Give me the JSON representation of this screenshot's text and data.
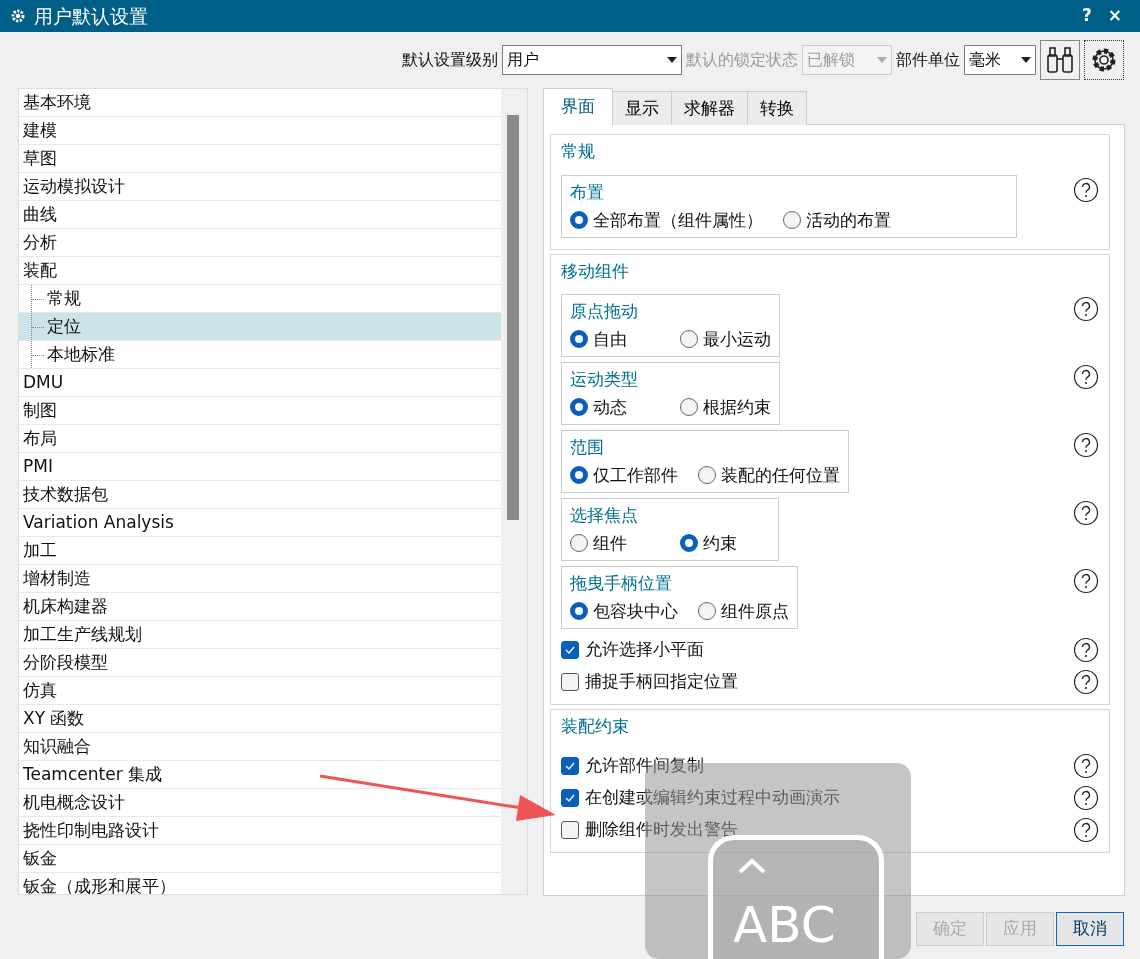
{
  "window": {
    "title": "用户默认设置",
    "help": "?",
    "close": "×"
  },
  "toolbar": {
    "level_label": "默认设置级别",
    "level_value": "用户",
    "lock_label": "默认的锁定状态",
    "lock_value": "已解锁",
    "lock_disabled": true,
    "units_label": "部件单位",
    "units_value": "毫米"
  },
  "sidebar": {
    "items": [
      {
        "label": "基本环境",
        "selected": false
      },
      {
        "label": "建模",
        "selected": false
      },
      {
        "label": "草图",
        "selected": false
      },
      {
        "label": "运动模拟设计",
        "selected": false
      },
      {
        "label": "曲线",
        "selected": false
      },
      {
        "label": "分析",
        "selected": false
      },
      {
        "label": "装配",
        "selected": false,
        "children": [
          {
            "label": "常规",
            "selected": false
          },
          {
            "label": "定位",
            "selected": true
          },
          {
            "label": "本地标准",
            "selected": false
          }
        ]
      },
      {
        "label": "DMU",
        "selected": false
      },
      {
        "label": "制图",
        "selected": false
      },
      {
        "label": "布局",
        "selected": false
      },
      {
        "label": "PMI",
        "selected": false
      },
      {
        "label": "技术数据包",
        "selected": false
      },
      {
        "label": "Variation Analysis",
        "selected": false
      },
      {
        "label": "加工",
        "selected": false
      },
      {
        "label": "增材制造",
        "selected": false
      },
      {
        "label": "机床构建器",
        "selected": false
      },
      {
        "label": "加工生产线规划",
        "selected": false
      },
      {
        "label": "分阶段模型",
        "selected": false
      },
      {
        "label": "仿真",
        "selected": false
      },
      {
        "label": "XY 函数",
        "selected": false
      },
      {
        "label": "知识融合",
        "selected": false
      },
      {
        "label": "Teamcenter 集成",
        "selected": false
      },
      {
        "label": "机电概念设计",
        "selected": false
      },
      {
        "label": "挠性印制电路设计",
        "selected": false
      },
      {
        "label": "钣金",
        "selected": false
      },
      {
        "label": "钣金（成形和展平）",
        "selected": false
      }
    ]
  },
  "tabs": [
    {
      "label": "界面",
      "selected": true
    },
    {
      "label": "显示",
      "selected": false
    },
    {
      "label": "求解器",
      "selected": false
    },
    {
      "label": "转换",
      "selected": false
    }
  ],
  "sections": [
    {
      "title": "常规",
      "items": [
        {
          "kind": "radio",
          "title": "布置",
          "options": [
            {
              "label": "全部布置（组件属性）",
              "selected": true
            },
            {
              "label": "活动的布置",
              "selected": false
            }
          ]
        }
      ]
    },
    {
      "title": "移动组件",
      "items": [
        {
          "kind": "radio",
          "title": "原点拖动",
          "options": [
            {
              "label": "自由",
              "selected": true
            },
            {
              "label": "最小运动",
              "selected": false
            }
          ]
        },
        {
          "kind": "radio",
          "title": "运动类型",
          "options": [
            {
              "label": "动态",
              "selected": true
            },
            {
              "label": "根据约束",
              "selected": false
            }
          ]
        },
        {
          "kind": "radio",
          "title": "范围",
          "options": [
            {
              "label": "仅工作部件",
              "selected": true
            },
            {
              "label": "装配的任何位置",
              "selected": false
            }
          ]
        },
        {
          "kind": "radio",
          "title": "选择焦点",
          "options": [
            {
              "label": "组件",
              "selected": false
            },
            {
              "label": "约束",
              "selected": true
            }
          ]
        },
        {
          "kind": "radio",
          "title": "拖曳手柄位置",
          "options": [
            {
              "label": "包容块中心",
              "selected": true
            },
            {
              "label": "组件原点",
              "selected": false
            }
          ]
        },
        {
          "kind": "checkbox",
          "label": "允许选择小平面",
          "checked": true
        },
        {
          "kind": "checkbox",
          "label": "捕捉手柄回指定位置",
          "checked": false
        }
      ]
    },
    {
      "title": "装配约束",
      "items": [
        {
          "kind": "checkbox",
          "label": "允许部件间复制",
          "checked": true
        },
        {
          "kind": "checkbox",
          "label": "在创建或编辑约束过程中动画演示",
          "checked": true
        },
        {
          "kind": "checkbox",
          "label": "删除组件时发出警告",
          "checked": false
        }
      ]
    }
  ],
  "buttons": [
    {
      "label": "确定",
      "disabled": true
    },
    {
      "label": "应用",
      "disabled": true
    },
    {
      "label": "取消",
      "disabled": false
    }
  ],
  "ime_indicator": {
    "label": "ABC"
  }
}
